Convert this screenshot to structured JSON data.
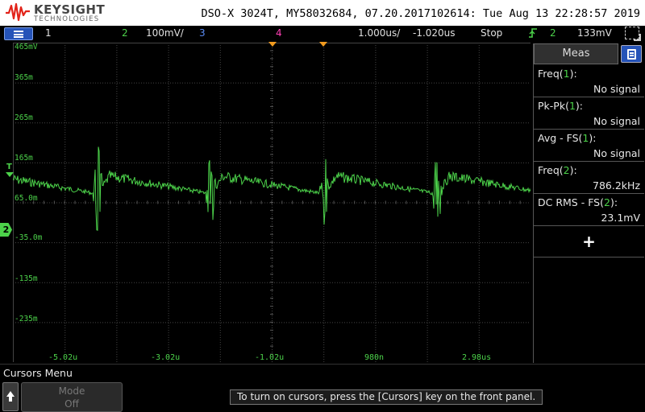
{
  "header": {
    "brand": "KEYSIGHT",
    "brand_sub": "TECHNOLOGIES",
    "title": "DSO-X 3024T, MY58032684, 07.20.2017102614: Tue Aug 13 22:28:57 2019"
  },
  "status": {
    "ch1": "1",
    "ch2": "2",
    "ch2_scale": "100mV/",
    "ch3": "3",
    "ch4": "4",
    "timebase": "1.000us/",
    "delay": "-1.020us",
    "run_state": "Stop",
    "trigger_icon": "rising-edge-icon",
    "trigger_source": "2",
    "trigger_level": "133mV"
  },
  "display": {
    "y_labels": [
      "465mV",
      "365m",
      "265m",
      "165m",
      "65.0m",
      "-35.0m",
      "-135m",
      "-235m"
    ],
    "x_labels": [
      "-5.02u",
      "-3.02u",
      "-1.02u",
      "980n",
      "2.98us"
    ],
    "ch2_marker": "2",
    "trigger_marker": "T"
  },
  "measurements": {
    "header": "Meas",
    "items": [
      {
        "name": "Freq",
        "ch": "1",
        "value": "No signal"
      },
      {
        "name": "Pk-Pk",
        "ch": "1",
        "value": "No signal"
      },
      {
        "name": "Avg - FS",
        "ch": "1",
        "value": "No signal"
      },
      {
        "name": "Freq",
        "ch": "2",
        "value": "786.2kHz"
      },
      {
        "name": "DC RMS - FS",
        "ch": "2",
        "value": "23.1mV"
      }
    ],
    "add_label": "+"
  },
  "softkeys": {
    "menu_title": "Cursors Menu",
    "mode_label": "Mode",
    "mode_value": "Off",
    "hint": "To turn on cursors, press the [Cursors] key on the front panel."
  },
  "colors": {
    "ch1": "#e0e0e0",
    "ch2": "#4cd24a",
    "ch3": "#5b8cf4",
    "ch4": "#ff3fb4",
    "marker": "#f29b1f",
    "menu_blue": "#2553b8"
  }
}
